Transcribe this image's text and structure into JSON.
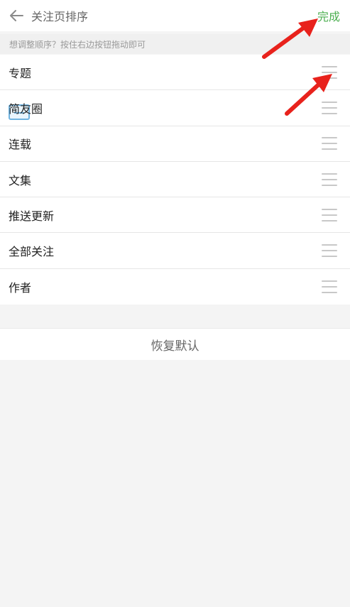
{
  "header": {
    "back_icon": "arrow-left-icon",
    "title": "关注页排序",
    "done_label": "完成",
    "done_color": "#4caf50"
  },
  "hint": "想调整顺序？按住右边按钮拖动即可",
  "items": [
    {
      "label": "专题"
    },
    {
      "label": "简友圈"
    },
    {
      "label": "连载"
    },
    {
      "label": "文集"
    },
    {
      "label": "推送更新"
    },
    {
      "label": "全部关注"
    },
    {
      "label": "作者"
    }
  ],
  "restore_label": "恢复默认",
  "annotation_color": "#e8221c"
}
